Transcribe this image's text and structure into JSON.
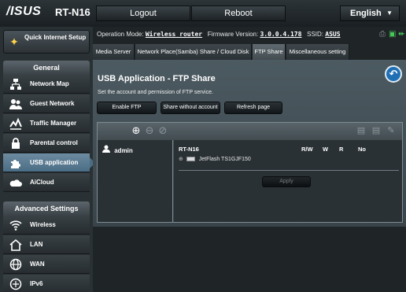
{
  "header": {
    "brand": "/ISUS",
    "model": "RT-N16",
    "logout": "Logout",
    "reboot": "Reboot",
    "language": "English"
  },
  "sidebar": {
    "quick_setup": "Quick Internet Setup",
    "general_title": "General",
    "general_items": [
      {
        "label": "Network Map",
        "icon": "network-map-icon"
      },
      {
        "label": "Guest Network",
        "icon": "guest-network-icon"
      },
      {
        "label": "Traffic Manager",
        "icon": "traffic-manager-icon"
      },
      {
        "label": "Parental control",
        "icon": "lock-icon"
      },
      {
        "label": "USB application",
        "icon": "puzzle-icon"
      },
      {
        "label": "AiCloud",
        "icon": "cloud-icon"
      }
    ],
    "advanced_title": "Advanced Settings",
    "advanced_items": [
      {
        "label": "Wireless",
        "icon": "wireless-icon"
      },
      {
        "label": "LAN",
        "icon": "home-icon"
      },
      {
        "label": "WAN",
        "icon": "globe-icon"
      },
      {
        "label": "IPv6",
        "icon": "ipv6-icon"
      }
    ]
  },
  "status": {
    "mode_label": "Operation Mode:",
    "mode_value": "Wireless router",
    "fw_label": "Firmware Version:",
    "fw_value": "3.0.0.4.178",
    "ssid_label": "SSID:",
    "ssid_value": "ASUS"
  },
  "tabs": [
    {
      "label": "Media Server"
    },
    {
      "label": "Network Place(Samba) Share / Cloud Disk"
    },
    {
      "label": "FTP Share"
    },
    {
      "label": "Miscellaneous setting"
    }
  ],
  "panel": {
    "title": "USB Application - FTP Share",
    "description": "Set the account and permission of FTP service.",
    "enable_ftp": "Enable FTP",
    "share_without_account": "Share without account",
    "refresh_page": "Refresh page"
  },
  "table": {
    "user": "admin",
    "device": "RT-N16",
    "col_rw": "R/W",
    "col_w": "W",
    "col_r": "R",
    "col_no": "No",
    "drive": "JetFlash TS1GJF150",
    "apply": "Apply"
  },
  "colors": {
    "active_nav": "#4a6d85",
    "back_button": "#1f6fb5",
    "usb_icon": "#47c95a"
  }
}
